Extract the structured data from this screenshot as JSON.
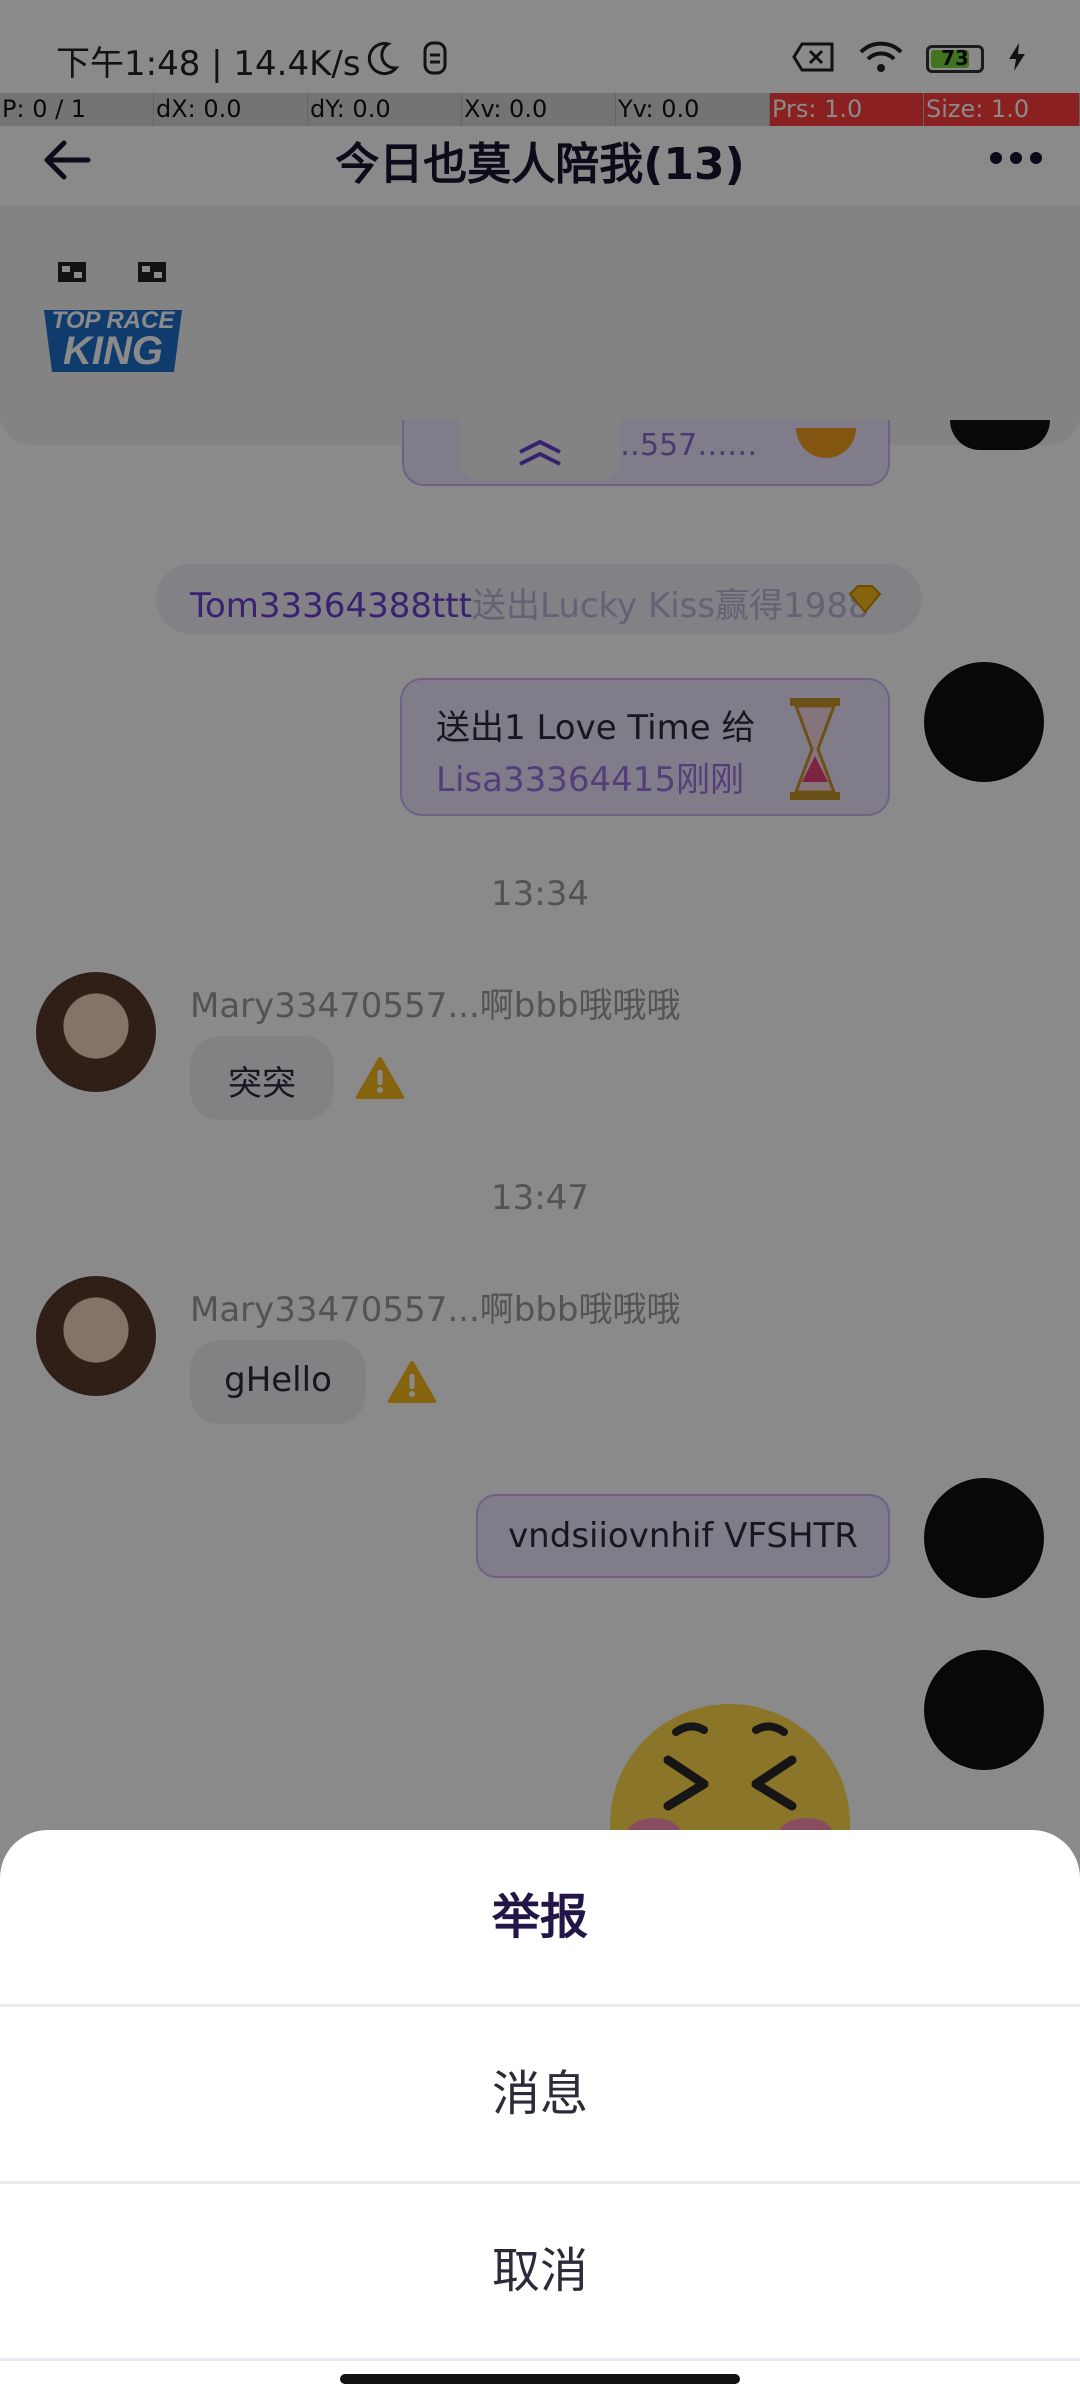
{
  "status_bar": {
    "left_text": "下午1:48 | 14.4K/s",
    "battery": "73",
    "battery_level_percent": 73
  },
  "debug_bar": {
    "cells": [
      "P: 0 / 1",
      "dX: 0.0",
      "dY: 0.0",
      "Xv: 0.0",
      "Yv: 0.0",
      "Prs: 1.0",
      "Size: 1.0"
    ]
  },
  "header": {
    "title": "今日也莫人陪我(13)"
  },
  "banner": {
    "logo_text_line1": "TOP RACE",
    "logo_text_line2": "KING"
  },
  "messages": {
    "partial_top_text": "…557……",
    "system_notice": {
      "name": "Tom33364388ttt",
      "text": "送出Lucky Kiss赢得1988"
    },
    "gift_message": {
      "line1": "送出1 Love Time 给",
      "line2": "Lisa33364415刚刚"
    },
    "time1": "13:34",
    "msg1": {
      "sender": "Mary33470557...啊bbb哦哦哦",
      "text": "突突"
    },
    "time2": "13:47",
    "msg2": {
      "sender": "Mary33470557...啊bbb哦哦哦",
      "text": "gHello"
    },
    "my_message": {
      "text": "vndsiiovnhif VFSHTR"
    }
  },
  "action_sheet": {
    "title": "举报",
    "option_message": "消息",
    "cancel": "取消"
  },
  "colors": {
    "accent": "#6a3fd1",
    "overlay": "rgba(0,0,0,0.46)"
  }
}
